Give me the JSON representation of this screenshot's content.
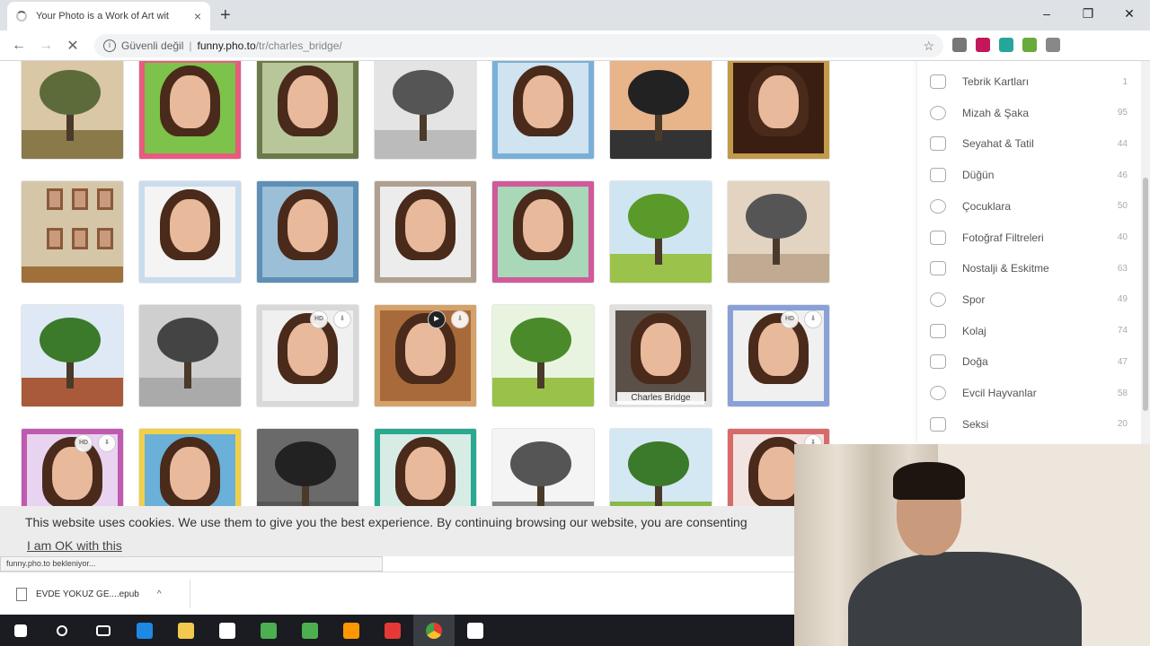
{
  "browser": {
    "tab_title": "Your Photo is a Work of Art wit",
    "tab_close": "×",
    "new_tab": "+",
    "window_controls": [
      "–",
      "❐",
      "✕"
    ],
    "security_label": "Güvenli değil",
    "url_domain": "funny.pho.to",
    "url_path": "/tr/charles_bridge/",
    "status_text": "funny.pho.to bekleniyor..."
  },
  "grid": {
    "tooltip_label": "Charles Bridge",
    "badge_hd": "HD",
    "thumbs": [
      {
        "kind": "tree",
        "bg": "#d9c7a6",
        "top": "#5d6b3a",
        "ground": "#8a7a4a"
      },
      {
        "kind": "portrait",
        "bg": "#7dc24a",
        "frame": "#e75b7e"
      },
      {
        "kind": "portrait",
        "bg": "#b8c79a",
        "frame": "#6a7a4a"
      },
      {
        "kind": "tree",
        "bg": "#e4e4e4",
        "top": "#555",
        "ground": "#bbb"
      },
      {
        "kind": "portrait",
        "bg": "#cfe3f0",
        "frame": "#7ab0d8"
      },
      {
        "kind": "tree",
        "bg": "#e8b48a",
        "top": "#222",
        "ground": "#333"
      },
      {
        "kind": "portrait",
        "bg": "#3a1e12",
        "frame": "#c29a4a"
      },
      {
        "kind": "frames",
        "bg": "#d6c6a8",
        "frame": "#8a5a3a"
      },
      {
        "kind": "portrait",
        "bg": "#f4f4f4",
        "frame": "#c9dcef"
      },
      {
        "kind": "portrait",
        "bg": "#9bbfd6",
        "frame": "#5e8fb5"
      },
      {
        "kind": "portrait",
        "bg": "#ececec",
        "frame": "#b0a090"
      },
      {
        "kind": "portrait",
        "bg": "#a8d8b8",
        "frame": "#d05a9a"
      },
      {
        "kind": "tree",
        "bg": "#cfe6f2",
        "top": "#5a9a2a",
        "ground": "#9bc24a"
      },
      {
        "kind": "tree",
        "bg": "#e3d4c2",
        "top": "#555",
        "ground": "#c0ab92"
      },
      {
        "kind": "tree",
        "bg": "#dfe9f5",
        "top": "#3a7a2a",
        "ground": "#a85a3a"
      },
      {
        "kind": "tree",
        "bg": "#cfcfcf",
        "top": "#444",
        "ground": "#aaa"
      },
      {
        "kind": "portrait",
        "bg": "#f0f0f0",
        "frame": "#d8d8d8"
      },
      {
        "kind": "portrait",
        "bg": "#a86a3a",
        "frame": "#d4a26a"
      },
      {
        "kind": "tree",
        "bg": "#e8f4e0",
        "top": "#4a8a2a",
        "ground": "#9ac24a"
      },
      {
        "kind": "portrait",
        "bg": "#5a5048",
        "frame": "#e0e0e0"
      },
      {
        "kind": "portrait",
        "bg": "#f0f0f0",
        "frame": "#8aa0d8"
      },
      {
        "kind": "portrait",
        "bg": "#e8d4f0",
        "frame": "#c05ab0"
      },
      {
        "kind": "portrait",
        "bg": "#6ab0d8",
        "frame": "#f0d04a"
      },
      {
        "kind": "tree",
        "bg": "#6a6a6a",
        "top": "#222",
        "ground": "#555"
      },
      {
        "kind": "portrait",
        "bg": "#d8ece6",
        "frame": "#2aa890"
      },
      {
        "kind": "tree",
        "bg": "#f4f4f4",
        "top": "#555",
        "ground": "#888"
      },
      {
        "kind": "tree",
        "bg": "#d4e8f4",
        "top": "#3a7a2a",
        "ground": "#8ab84a"
      },
      {
        "kind": "portrait",
        "bg": "#f2e4e0",
        "frame": "#d86a6a"
      }
    ]
  },
  "sidebar": {
    "categories": [
      {
        "label": "Tebrik Kartları",
        "count": "1"
      },
      {
        "label": "Mizah & Şaka",
        "count": "95"
      },
      {
        "label": "Seyahat & Tatil",
        "count": "44"
      },
      {
        "label": "Düğün",
        "count": "46"
      },
      {
        "label": "Çocuklara",
        "count": "50"
      },
      {
        "label": "Fotoğraf Filtreleri",
        "count": "40"
      },
      {
        "label": "Nostalji & Eskitme",
        "count": "63"
      },
      {
        "label": "Spor",
        "count": "49"
      },
      {
        "label": "Kolaj",
        "count": "74"
      },
      {
        "label": "Doğa",
        "count": "47"
      },
      {
        "label": "Evcil Hayvanlar",
        "count": "58"
      },
      {
        "label": "Seksi",
        "count": "20"
      }
    ]
  },
  "cookie_bar": {
    "text": "This website uses cookies. We use them to give you the best experience. By continuing browsing our website, you are consenting",
    "ok_link": "I am OK with this"
  },
  "download": {
    "filename": "EVDE YOKUZ GE....epub",
    "chevron": "^"
  },
  "colors": {
    "ext_colors": [
      "#777",
      "#c2185b",
      "#26a69a",
      "#6aaa3a",
      "#888"
    ],
    "taskbar_icons": [
      "#ffffff",
      "#ffffff",
      "#ffffff",
      "#1e88e5",
      "#f2c94c",
      "#ffffff",
      "#4caf50",
      "#4caf50",
      "#ff9800",
      "#e53935",
      "#e0e0e0",
      "#ffffff"
    ]
  }
}
